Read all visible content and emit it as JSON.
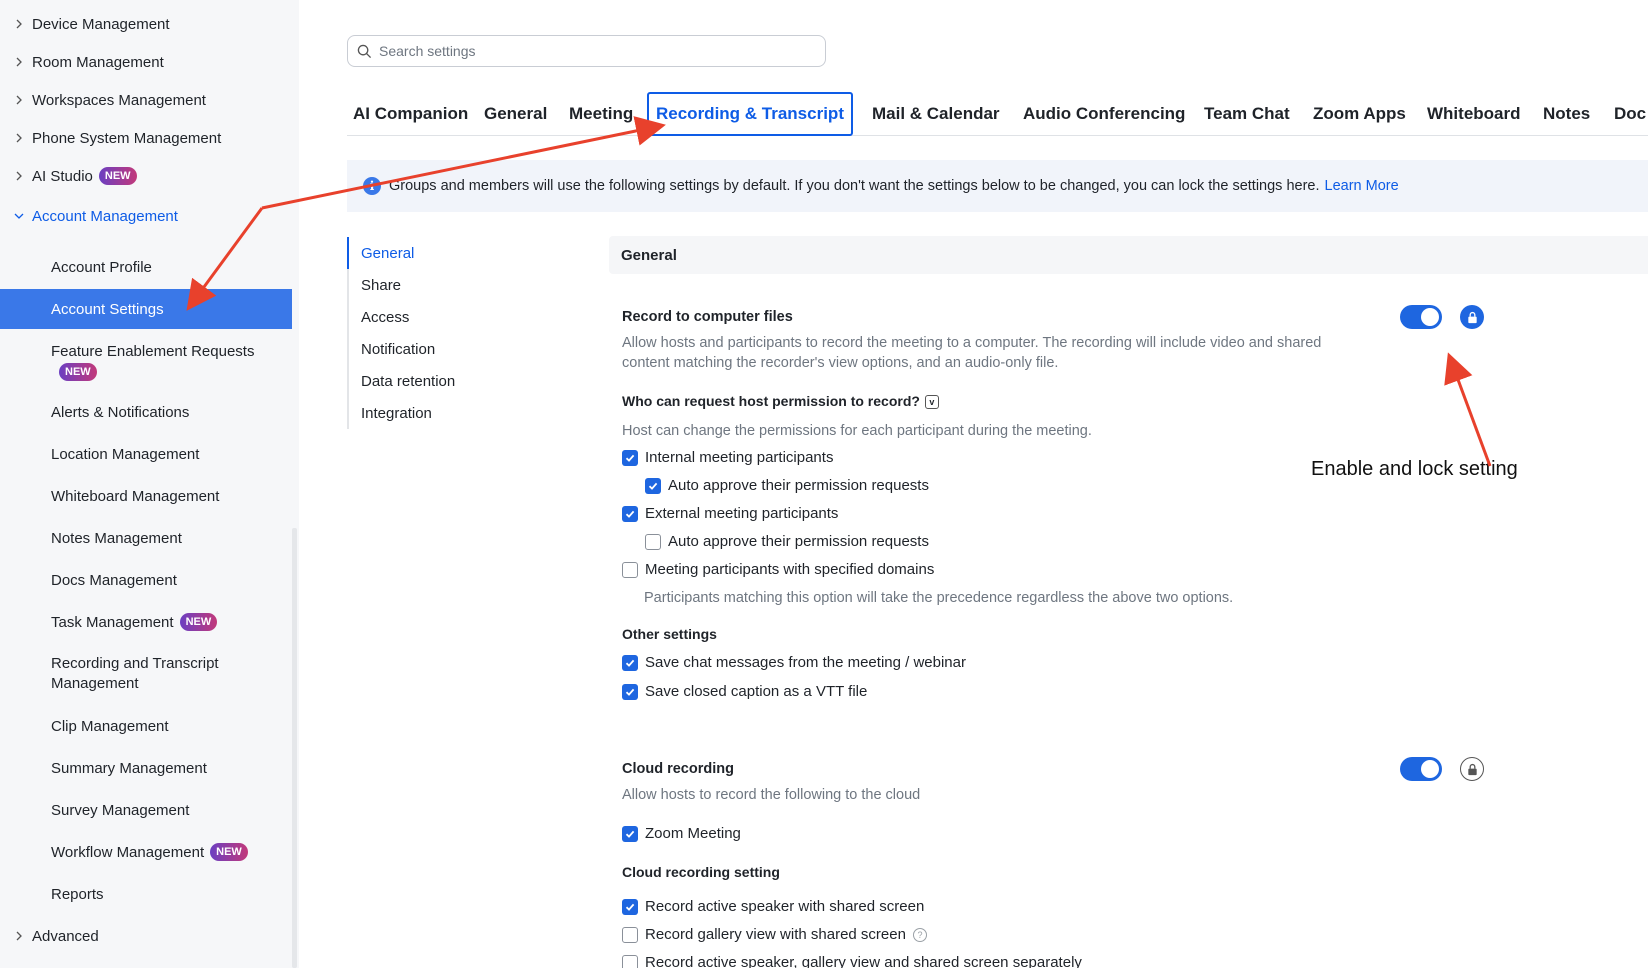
{
  "sidebar": {
    "items": [
      {
        "label": "Device Management"
      },
      {
        "label": "Room Management"
      },
      {
        "label": "Workspaces Management"
      },
      {
        "label": "Phone System Management"
      },
      {
        "label": "AI Studio",
        "badge": "NEW"
      },
      {
        "label": "Account Management"
      },
      {
        "label": "Account Profile"
      },
      {
        "label": "Account Settings"
      },
      {
        "label": "Feature Enablement Requests",
        "badge": "NEW"
      },
      {
        "label": "Alerts & Notifications"
      },
      {
        "label": "Location Management"
      },
      {
        "label": "Whiteboard Management"
      },
      {
        "label": "Notes Management"
      },
      {
        "label": "Docs Management"
      },
      {
        "label": "Task Management",
        "badge": "NEW"
      },
      {
        "label": "Recording and Transcript",
        "label2": "Management"
      },
      {
        "label": "Clip Management"
      },
      {
        "label": "Summary Management"
      },
      {
        "label": "Survey Management"
      },
      {
        "label": "Workflow Management",
        "badge": "NEW"
      },
      {
        "label": "Reports"
      },
      {
        "label": "Advanced"
      }
    ]
  },
  "search": {
    "placeholder": "Search settings"
  },
  "tabs": [
    "AI Companion",
    "General",
    "Meeting",
    "Recording & Transcript",
    "Mail & Calendar",
    "Audio Conferencing",
    "Team Chat",
    "Zoom Apps",
    "Whiteboard",
    "Notes",
    "Doc"
  ],
  "info": {
    "text": "Groups and members will use the following settings by default. If you don't want the settings below to be changed, you can lock the settings here.",
    "link": "Learn More"
  },
  "subnav": [
    "General",
    "Share",
    "Access",
    "Notification",
    "Data retention",
    "Integration"
  ],
  "section": {
    "title": "General"
  },
  "record_local": {
    "title": "Record to computer files",
    "desc1": "Allow hosts and participants to record the meeting to a computer. The recording will include video and shared",
    "desc2": "content matching the recorder's view options, and an audio-only file.",
    "who_title": "Who can request host permission to record?",
    "who_desc": "Host can change the permissions for each participant during the meeting.",
    "opt_internal": "Internal meeting participants",
    "opt_internal_auto": "Auto approve their permission requests",
    "opt_external": "External meeting participants",
    "opt_external_auto": "Auto approve their permission requests",
    "opt_domains": "Meeting participants with specified domains",
    "domains_note": "Participants matching this option will take the precedence regardless the above two options.",
    "other_title": "Other settings",
    "opt_chat": "Save chat messages from the meeting / webinar",
    "opt_vtt": "Save closed caption as a VTT file"
  },
  "cloud": {
    "title": "Cloud recording",
    "desc": "Allow hosts to record the following to the cloud",
    "opt_zoom": "Zoom Meeting",
    "setting_title": "Cloud recording setting",
    "opt_active_shared": "Record active speaker with shared screen",
    "opt_gallery_shared": "Record gallery view with shared screen",
    "opt_separately": "Record active speaker, gallery view and shared screen separately"
  },
  "annotation": {
    "text": "Enable and lock setting",
    "arrow_color": "#e8412c"
  },
  "colors": {
    "accent": "#0e5ce6",
    "active_bg": "#3a78e8"
  }
}
